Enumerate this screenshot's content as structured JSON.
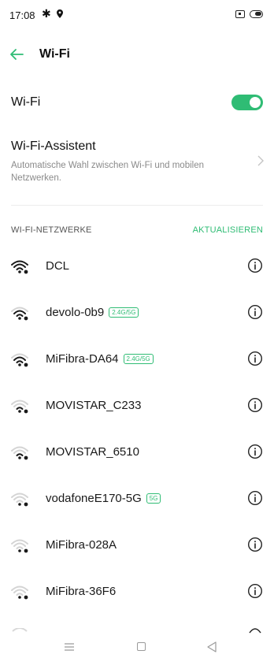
{
  "status_bar": {
    "time": "17:08",
    "icons": [
      "gear-icon",
      "location-icon",
      "nfc-icon",
      "battery-icon"
    ]
  },
  "header": {
    "title": "Wi-Fi",
    "back_icon": "back-arrow-icon"
  },
  "wifi_toggle": {
    "label": "Wi-Fi",
    "enabled": true
  },
  "assistant": {
    "title": "Wi-Fi-Assistent",
    "description": "Automatische Wahl zwischen Wi-Fi und mobilen Netzwerken."
  },
  "networks_section": {
    "title": "WI-FI-NETZWERKE",
    "refresh_label": "AKTUALISIEREN"
  },
  "networks": [
    {
      "name": "DCL",
      "band": "",
      "signal": 4
    },
    {
      "name": "devolo-0b9",
      "band": "2.4G/5G",
      "signal": 3
    },
    {
      "name": "MiFibra-DA64",
      "band": "2.4G/5G",
      "signal": 3
    },
    {
      "name": "MOVISTAR_C233",
      "band": "",
      "signal": 2
    },
    {
      "name": "MOVISTAR_6510",
      "band": "",
      "signal": 2
    },
    {
      "name": "vodafoneE170-5G",
      "band": "5G",
      "signal": 1
    },
    {
      "name": "MiFibra-028A",
      "band": "",
      "signal": 1
    },
    {
      "name": "MiFibra-36F6",
      "band": "",
      "signal": 1
    }
  ],
  "colors": {
    "accent": "#2fbc74",
    "text": "#1a1a1a",
    "secondary_text": "#8a8a8a"
  },
  "nav_bar": {
    "icons": [
      "menu-icon",
      "home-icon",
      "back-icon"
    ]
  }
}
